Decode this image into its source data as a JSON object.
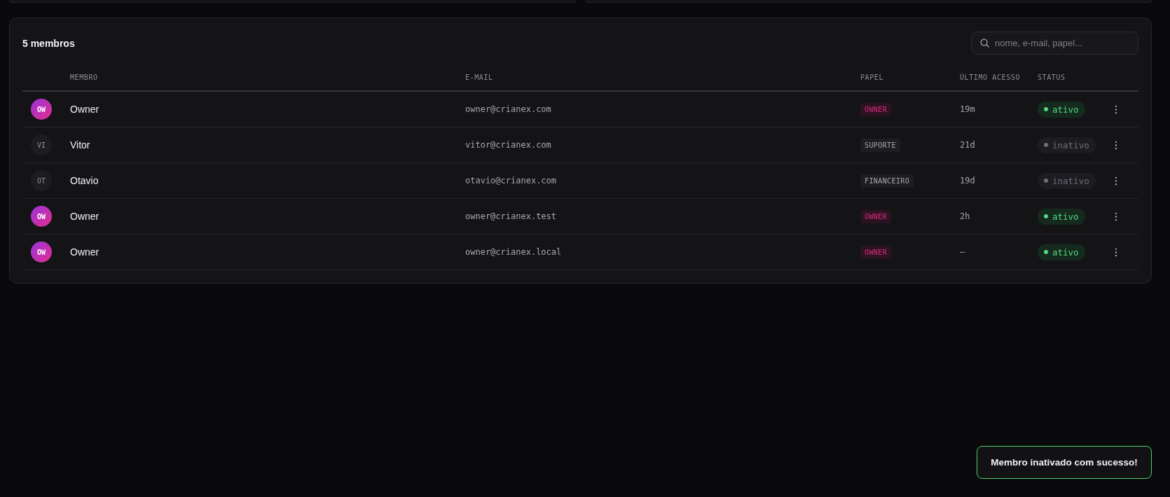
{
  "members_panel": {
    "count_label": "5 membros",
    "search": {
      "placeholder": "nome, e-mail, papel..."
    },
    "table": {
      "columns": [
        "MEMBRO",
        "E-MAIL",
        "PAPEL",
        "ÚLTIMO ACESSO",
        "STATUS"
      ],
      "rows": [
        {
          "kind": "owner",
          "initials": "OW",
          "name": "Owner",
          "email": "owner@crianex.com",
          "role": "OWNER",
          "last_access": "19m",
          "status": "ativo",
          "active": true
        },
        {
          "kind": "member",
          "initials": "VI",
          "name": "Vitor",
          "email": "vitor@crianex.com",
          "role": "SUPORTE",
          "last_access": "21d",
          "status": "inativo",
          "active": false
        },
        {
          "kind": "member",
          "initials": "OT",
          "name": "Otavio",
          "email": "otavio@crianex.com",
          "role": "FINANCEIRO",
          "last_access": "19d",
          "status": "inativo",
          "active": false
        },
        {
          "kind": "owner",
          "initials": "OW",
          "name": "Owner",
          "email": "owner@crianex.test",
          "role": "OWNER",
          "last_access": "2h",
          "status": "ativo",
          "active": true
        },
        {
          "kind": "owner",
          "initials": "OW",
          "name": "Owner",
          "email": "owner@crianex.local",
          "role": "OWNER",
          "last_access": "—",
          "status": "ativo",
          "active": true
        }
      ]
    }
  },
  "toast": {
    "kind": "success",
    "message": "Membro inativado com sucesso!"
  }
}
